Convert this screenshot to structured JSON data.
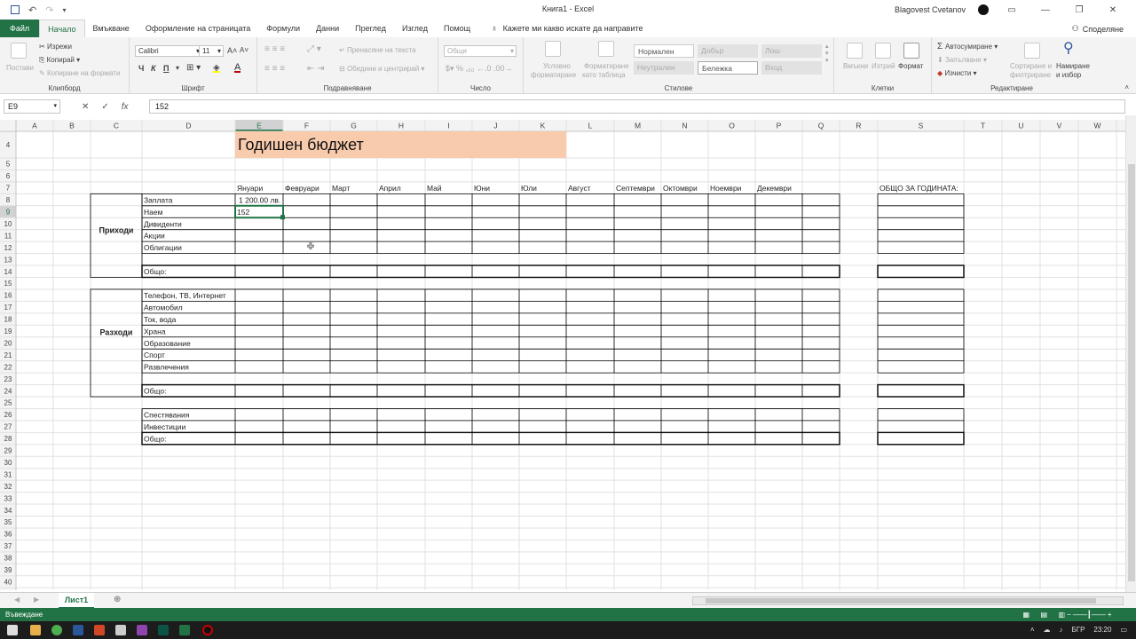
{
  "window": {
    "title": "Книга1  -  Excel",
    "user": "Blagovest Cvetanov",
    "share": "Споделяне"
  },
  "tabs": [
    "Файл",
    "Начало",
    "Вмъкване",
    "Оформление на страницата",
    "Формули",
    "Данни",
    "Преглед",
    "Изглед",
    "Помощ"
  ],
  "tell_me": "Кажете ми какво искате да направите",
  "ribbon": {
    "clipboard": {
      "label": "Клипборд",
      "paste": "Постави",
      "cut": "Изрежи",
      "copy": "Копирай",
      "format_painter": "Копиране на формати"
    },
    "font": {
      "label": "Шрифт",
      "name": "Calibri",
      "size": "11",
      "bold": "Ч",
      "italic": "К",
      "underline": "П"
    },
    "alignment": {
      "label": "Подравняване",
      "wrap": "Пренасяне на текста",
      "merge": "Обедини и центрирай"
    },
    "number": {
      "label": "Число",
      "format": "Общи"
    },
    "styles": {
      "label": "Стилове",
      "conditional": "Условно",
      "conditional2": "форматиране",
      "as_table": "Форматиране",
      "as_table2": "като таблица",
      "cells": [
        "Нормален",
        "Добър",
        "Лош",
        "Неутрален",
        "Бележка",
        "Вход"
      ]
    },
    "cells_grp": {
      "label": "Клетки",
      "insert": "Вмъкни",
      "delete": "Изтрий",
      "format": "Формат"
    },
    "editing": {
      "label": "Редактиране",
      "autosum": "Автосумиране",
      "fill": "Запълване",
      "clear": "Изчисти",
      "sort": "Сортиране и",
      "sort2": "филтриране",
      "find": "Намиране",
      "find2": "и избор"
    }
  },
  "formula_bar": {
    "name_box": "E9",
    "value": "152",
    "cancel": "✕",
    "enter": "✓",
    "fx": "fx"
  },
  "columns": [
    "A",
    "B",
    "C",
    "D",
    "E",
    "F",
    "G",
    "H",
    "I",
    "J",
    "K",
    "L",
    "M",
    "N",
    "O",
    "P",
    "Q",
    "R",
    "S",
    "T",
    "U",
    "V",
    "W"
  ],
  "rows": [
    4,
    5,
    6,
    7,
    8,
    9,
    10,
    11,
    12,
    13,
    14,
    15,
    16,
    17,
    18,
    19,
    20,
    21,
    22,
    23,
    24,
    25,
    26,
    27,
    28,
    29,
    30,
    31,
    32,
    33,
    34,
    35,
    36,
    37,
    38,
    39,
    40
  ],
  "sheet": {
    "title": "Годишен бюджет",
    "months": [
      "Януари",
      "Февруари",
      "Март",
      "Април",
      "Май",
      "Юни",
      "Юли",
      "Август",
      "Септември",
      "Октомври",
      "Ноември",
      "Декември"
    ],
    "year_total": "ОБЩО ЗА ГОДИНАТА:",
    "income_label": "Приходи",
    "income_items": [
      "Заплата",
      "Наем",
      "Дивиденти",
      "Акции",
      "Облигации"
    ],
    "expense_label": "Разходи",
    "expense_items": [
      "Телефон, ТВ, Интернет",
      "Автомобил",
      "Ток, вода",
      "Храна",
      "Образование",
      "Спорт",
      "Развлечения"
    ],
    "savings_items": [
      "Спестявания",
      "Инвестиции"
    ],
    "total_label": "Общо:",
    "e8_value": "1 200.00 лв.",
    "e9_value": "152"
  },
  "sheet_tab": "Лист1",
  "status": "Въвеждане",
  "tray": {
    "lang": "БГР",
    "time": "23:20"
  },
  "colors": {
    "accent": "#217346",
    "title_fill": "#f8cbad"
  }
}
